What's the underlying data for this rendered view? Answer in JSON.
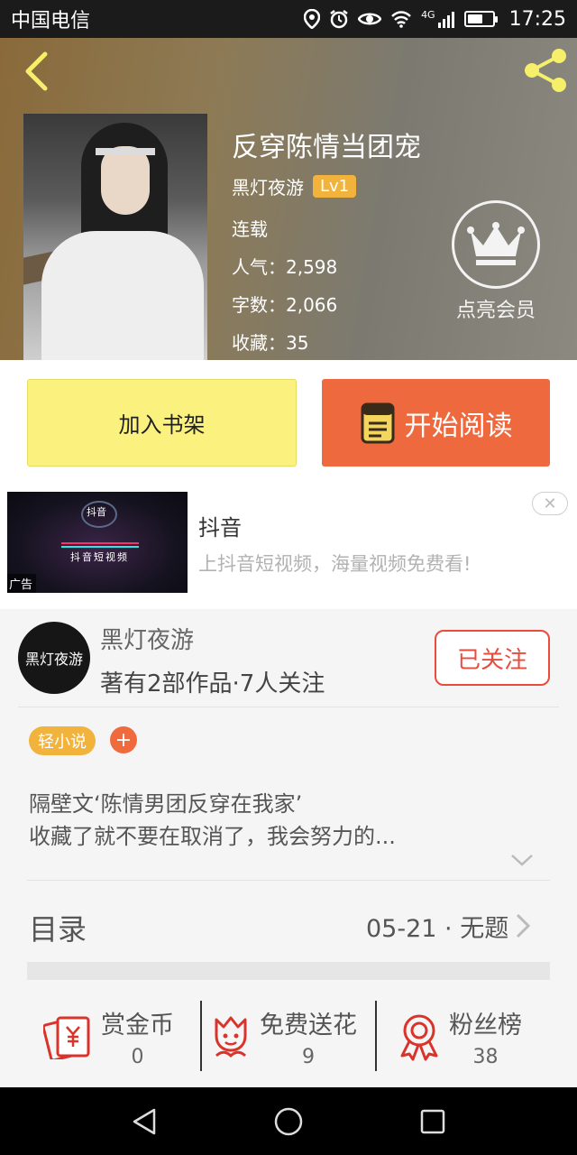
{
  "status_bar": {
    "carrier": "中国电信",
    "network": "4G",
    "time": "17:25",
    "battery_level": 0.65
  },
  "header": {
    "back_icon": "chevron-left-icon",
    "share_icon": "share-icon",
    "title": "反穿陈情当团宠",
    "author": "黑灯夜游",
    "level": "Lv1",
    "status": "连载",
    "popularity": "人气：2,598",
    "word_count": "字数：2,066",
    "favorites": "收藏：35",
    "vip_label": "点亮会员",
    "vip_icon": "crown-icon"
  },
  "actions": {
    "add_shelf": "加入书架",
    "start_reading": "开始阅读"
  },
  "ad": {
    "app_name": "抖音",
    "slogan": "抖音短视频",
    "title": "抖音",
    "description": "上抖音短视频，海量视频免费看!",
    "tag": "广告"
  },
  "author_block": {
    "name": "黑灯夜游",
    "stats": "著有2部作品·7人关注",
    "follow": "已关注",
    "avatar_text": "黑灯夜游",
    "tag": "轻小说",
    "tag_add": "+",
    "description_line1": "隔壁文‘陈情男团反穿在我家’",
    "description_line2": "收藏了就不要在取消了，我会努力的..."
  },
  "catalog": {
    "label": "目录",
    "latest": "05-21 · 无题"
  },
  "stats": [
    {
      "label": "赏金币",
      "value": "0",
      "icon": "red-packet-icon"
    },
    {
      "label": "免费送花",
      "value": "9",
      "icon": "flower-icon"
    },
    {
      "label": "粉丝榜",
      "value": "38",
      "icon": "medal-icon"
    }
  ],
  "colors": {
    "accent_orange": "#ee6a3e",
    "accent_yellow": "#fbf17f",
    "follow_red": "#e94c3d",
    "tag_gold": "#f2b33d"
  }
}
